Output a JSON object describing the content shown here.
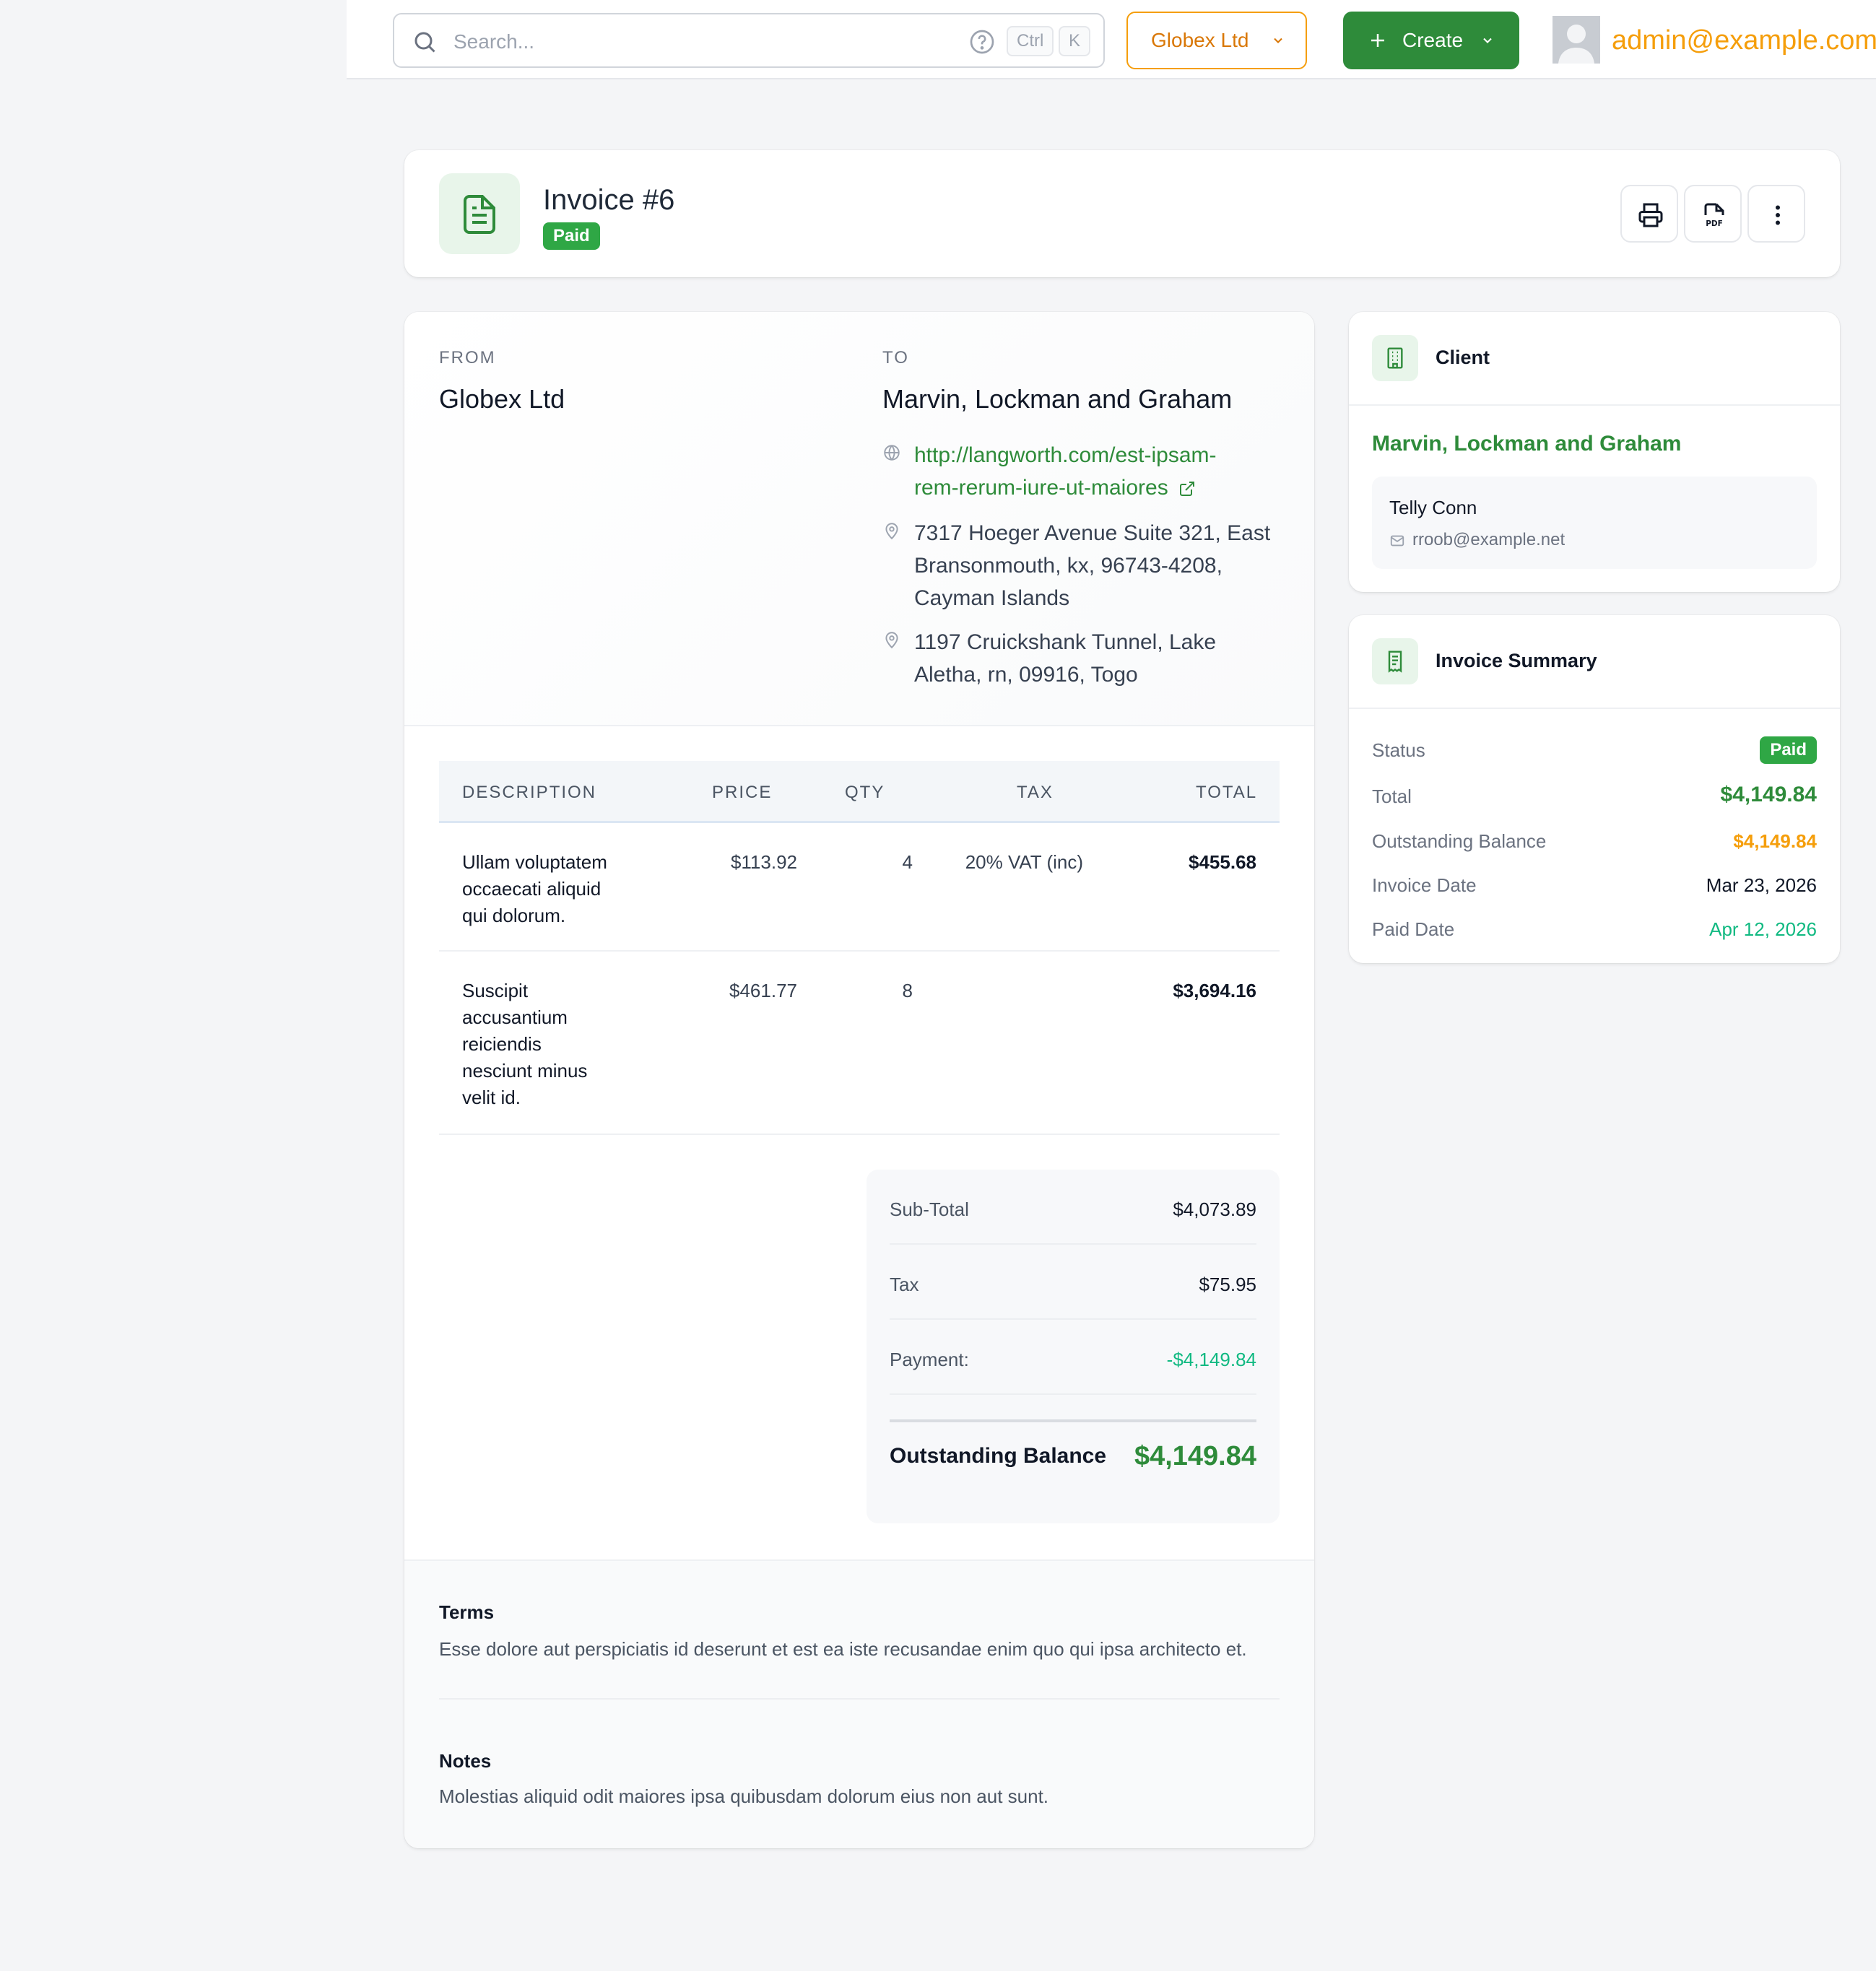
{
  "topbar": {
    "search_placeholder": "Search...",
    "kbd_ctrl": "Ctrl",
    "kbd_k": "K",
    "company_label": "Globex Ltd",
    "create_label": "Create",
    "user_email": "admin@example.com"
  },
  "invoice": {
    "title": "Invoice #6",
    "status": "Paid"
  },
  "parties": {
    "from_label": "FROM",
    "from_name": "Globex Ltd",
    "to_label": "TO",
    "to_name": "Marvin, Lockman and Graham",
    "website_line1": "http://langworth.com/est-ipsam-",
    "website_line2": "rem-rerum-iure-ut-maiores",
    "address1": [
      "7317 Hoeger Avenue Suite 321, East",
      "Bransonmouth, kx, 96743-4208,",
      "Cayman Islands"
    ],
    "address2": [
      "1197 Cruickshank Tunnel, Lake",
      "Aletha, rn, 09916, Togo"
    ]
  },
  "table": {
    "headers": {
      "description": "DESCRIPTION",
      "price": "PRICE",
      "qty": "QTY",
      "tax": "TAX",
      "total": "TOTAL"
    },
    "rows": [
      {
        "description_lines": [
          "Ullam voluptatem",
          "occaecati aliquid",
          "qui dolorum."
        ],
        "price": "$113.92",
        "qty": "4",
        "tax": "20% VAT (inc)",
        "total": "$455.68"
      },
      {
        "description_lines": [
          "Suscipit",
          "accusantium",
          "reiciendis",
          "nesciunt minus",
          "velit id."
        ],
        "price": "$461.77",
        "qty": "8",
        "tax": "",
        "total": "$3,694.16"
      }
    ]
  },
  "totals": {
    "subtotal_label": "Sub-Total",
    "subtotal": "$4,073.89",
    "tax_label": "Tax",
    "tax": "$75.95",
    "payment_label": "Payment:",
    "payment": "-$4,149.84",
    "outstanding_label": "Outstanding Balance",
    "outstanding": "$4,149.84"
  },
  "terms": {
    "title": "Terms",
    "body": "Esse dolore aut perspiciatis id deserunt et est ea iste recusandae enim quo qui ipsa architecto et."
  },
  "notes": {
    "title": "Notes",
    "body": "Molestias aliquid odit maiores ipsa quibusdam dolorum eius non aut sunt."
  },
  "client": {
    "title": "Client",
    "name": "Marvin, Lockman and Graham",
    "contact_name": "Telly Conn",
    "contact_email": "rroob@example.net"
  },
  "summary": {
    "title": "Invoice Summary",
    "status_label": "Status",
    "status": "Paid",
    "total_label": "Total",
    "total": "$4,149.84",
    "outstanding_label": "Outstanding Balance",
    "outstanding": "$4,149.84",
    "invoice_date_label": "Invoice Date",
    "invoice_date": "Mar 23, 2026",
    "paid_date_label": "Paid Date",
    "paid_date": "Apr 12, 2026"
  },
  "colors": {
    "brand_green": "#2e8b3a",
    "accent_orange": "#f59e0b",
    "teal": "#10b981",
    "background": "#f4f5f7"
  },
  "icons": [
    "search-icon",
    "help-icon",
    "chevron-down-icon",
    "plus-icon",
    "avatar",
    "document-icon",
    "print-icon",
    "pdf-icon",
    "more-vertical-icon",
    "globe-icon",
    "external-link-icon",
    "map-pin-icon",
    "building-icon",
    "mail-icon",
    "receipt-icon"
  ]
}
